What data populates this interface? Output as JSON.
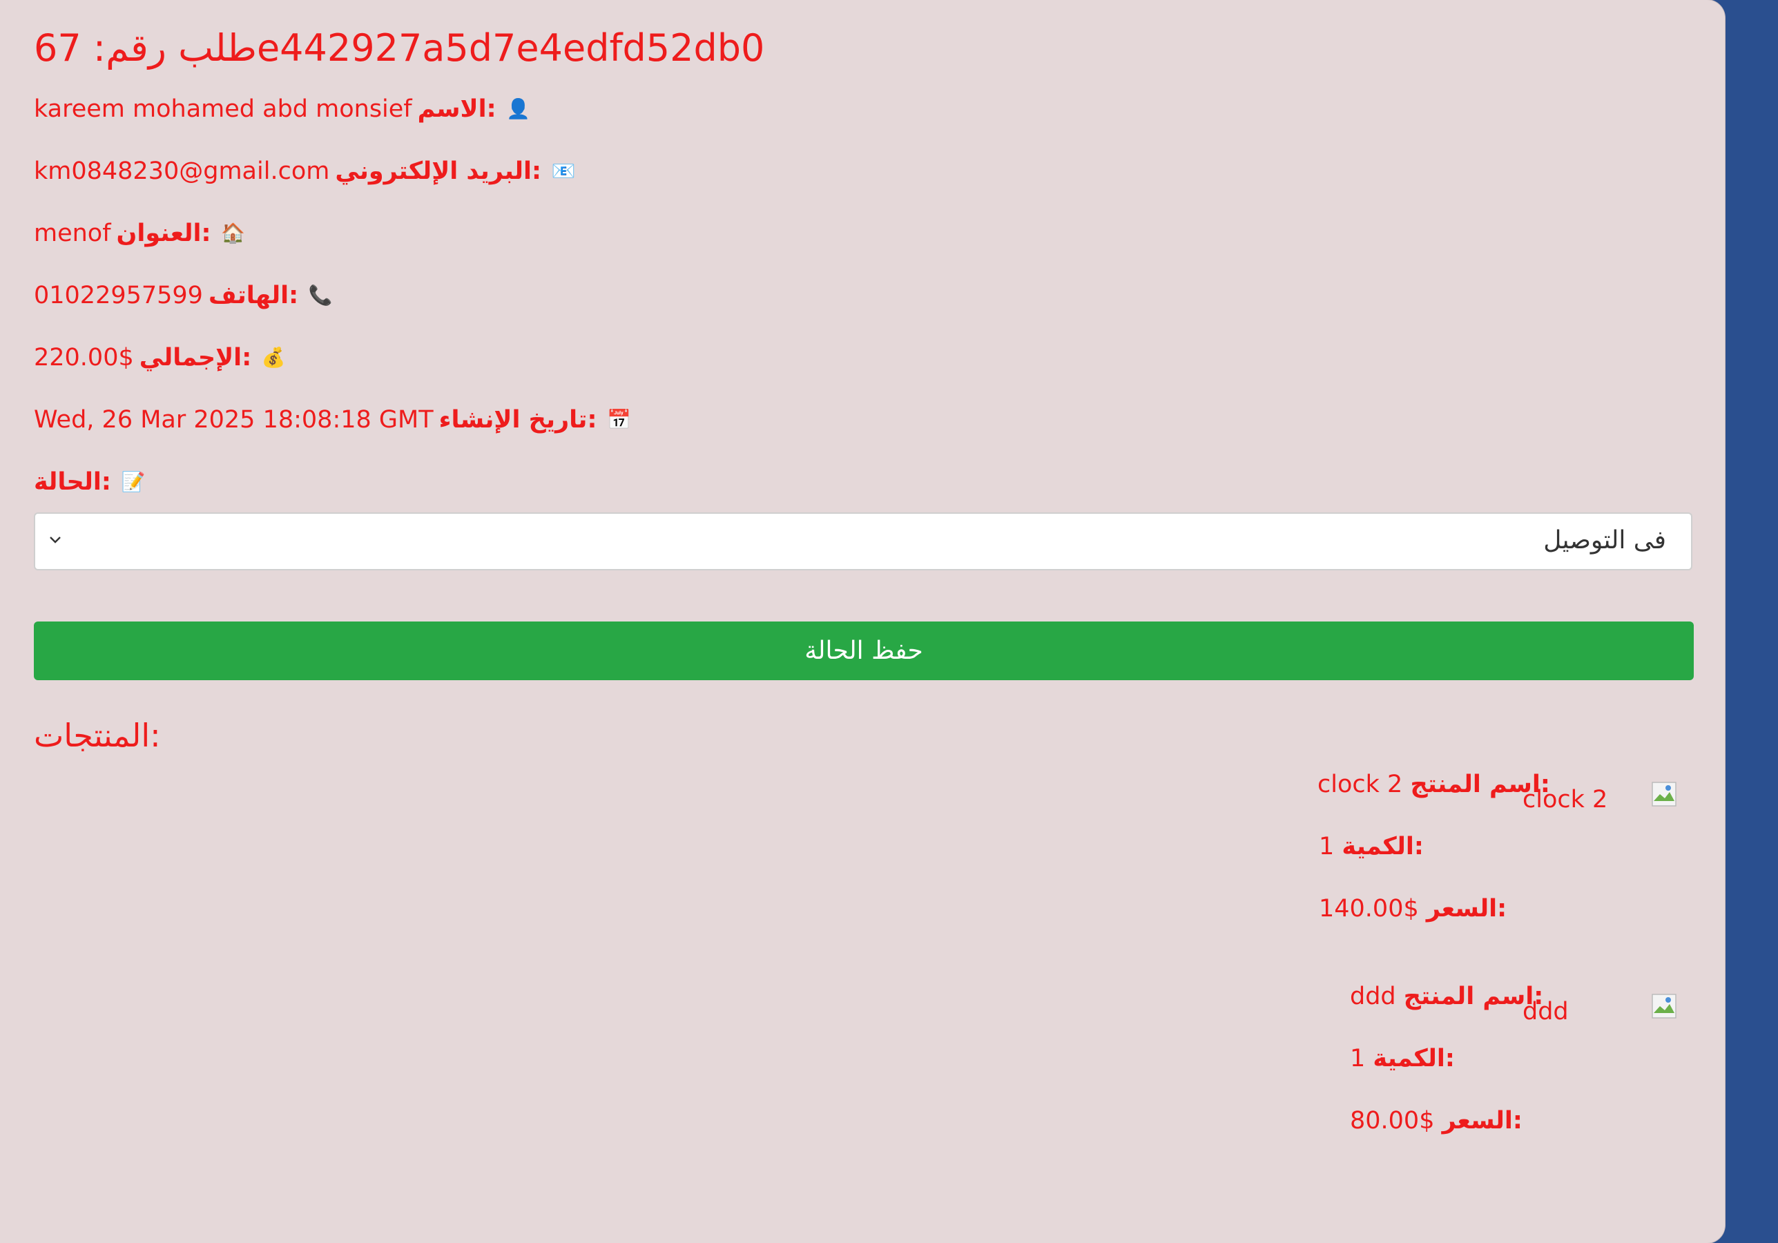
{
  "order": {
    "title": "طلب رقم: 67e442927a5d7e4edfd52db0"
  },
  "info": [
    {
      "icon": "person-icon",
      "glyph": "👤",
      "label": "الاسم:",
      "value": "kareem mohamed abd monsief"
    },
    {
      "icon": "email-icon",
      "glyph": "📧",
      "label": "البريد الإلكتروني:",
      "value": "km0848230@gmail.com"
    },
    {
      "icon": "house-icon",
      "glyph": "🏠",
      "label": "العنوان:",
      "value": "menof"
    },
    {
      "icon": "phone-icon",
      "glyph": "📞",
      "label": "الهاتف:",
      "value": "01022957599"
    },
    {
      "icon": "money-bag-icon",
      "glyph": "💰",
      "label": "الإجمالي:",
      "value": "220.00$"
    },
    {
      "icon": "calendar-icon",
      "glyph": "📅",
      "label": "تاريخ الإنشاء:",
      "value": "Wed, 26 Mar 2025 18:08:18 GMT"
    },
    {
      "icon": "memo-icon",
      "glyph": "📝",
      "label": "الحالة:",
      "value": ""
    }
  ],
  "status_select": {
    "selected": "فى التوصيل"
  },
  "save_button": {
    "label": "حفظ الحالة"
  },
  "products_heading": "المنتجات:",
  "products": [
    {
      "image_alt": "clock 2",
      "name_label": "اسم المنتج:",
      "name": "clock 2",
      "qty_label": "الكمية:",
      "qty": "1",
      "price_label": "السعر:",
      "price": "140.00$"
    },
    {
      "image_alt": "ddd",
      "name_label": "اسم المنتج:",
      "name": "ddd",
      "qty_label": "الكمية:",
      "qty": "1",
      "price_label": "السعر:",
      "price": "80.00$"
    }
  ],
  "colors": {
    "text_red": "#ee1c1c",
    "card_bg": "#e5d8d9",
    "page_bg": "#2a4f8f",
    "button_green": "#28a745"
  }
}
